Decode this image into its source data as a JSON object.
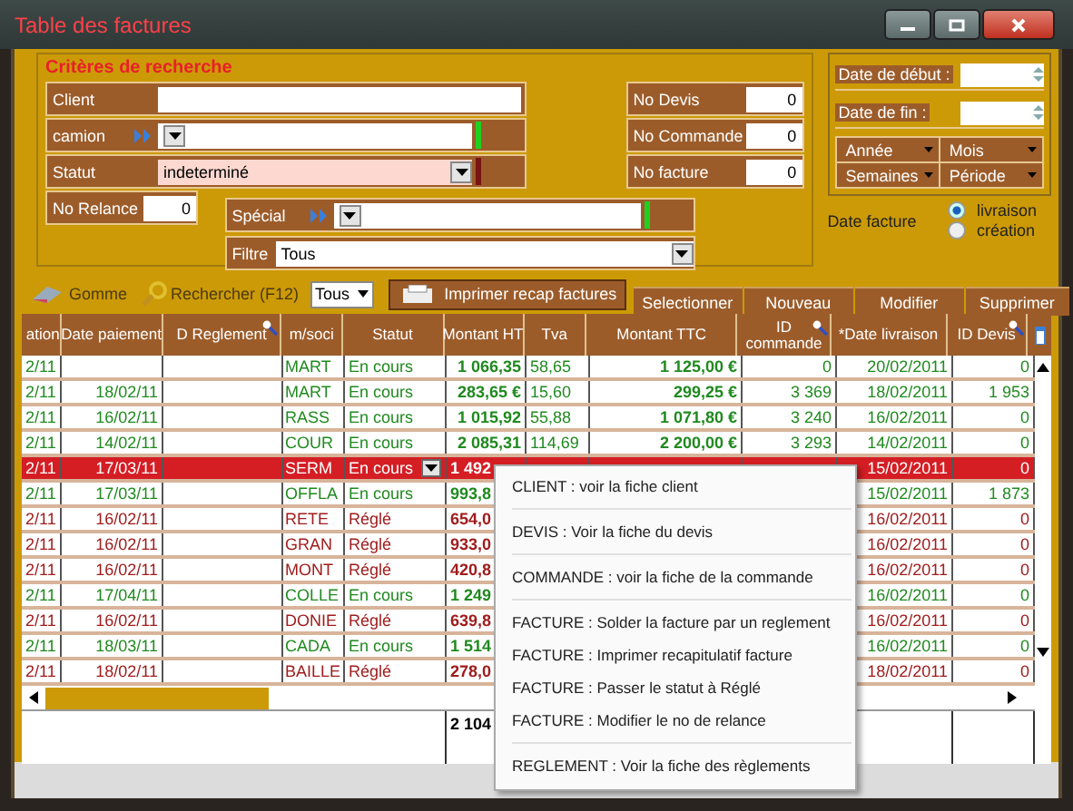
{
  "window": {
    "title": "Table des factures"
  },
  "criteria": {
    "title": "Critères de recherche",
    "client": {
      "label": "Client"
    },
    "camion": {
      "label": "camion"
    },
    "statut": {
      "label": "Statut",
      "value": "indeterminé"
    },
    "no_relance": {
      "label": "No Relance",
      "value": "0"
    },
    "numbers": [
      {
        "label": "No Devis",
        "value": "0"
      },
      {
        "label": "No Commande",
        "value": "0"
      },
      {
        "label": "No facture",
        "value": "0"
      }
    ],
    "special": {
      "label": "Spécial"
    },
    "filtre": {
      "label": "Filtre",
      "value": "Tous"
    },
    "dates": [
      {
        "label": "Date de début :"
      },
      {
        "label": "Date de fin :"
      }
    ],
    "periods": [
      "Année",
      "Mois",
      "Semaines",
      "Période"
    ],
    "date_facture": {
      "label": "Date facture",
      "options": [
        {
          "label": "livraison",
          "selected": true
        },
        {
          "label": "création",
          "selected": false
        }
      ]
    }
  },
  "toolbar": {
    "gomme": "Gomme",
    "search": "Rechercher (F12)",
    "scope": "Tous",
    "print": "Imprimer recap factures",
    "actions": [
      "Selectionner",
      "Nouveau",
      "Modifier",
      "Supprimer"
    ]
  },
  "table": {
    "columns": [
      {
        "label": "ation",
        "search_icon": false
      },
      {
        "label": "Date paiement",
        "search_icon": false
      },
      {
        "label": "D Reglement",
        "search_icon": true
      },
      {
        "label": "m/soci",
        "search_icon": false
      },
      {
        "label": "Statut",
        "search_icon": false
      },
      {
        "label": "Montant HT",
        "search_icon": false
      },
      {
        "label": "Tva",
        "search_icon": false
      },
      {
        "label": "Montant TTC",
        "search_icon": false
      },
      {
        "label": "ID commande",
        "search_icon": true
      },
      {
        "label": "*Date livraison",
        "search_icon": false
      },
      {
        "label": "ID Devis",
        "search_icon": true
      }
    ],
    "rows": [
      {
        "selected": false,
        "color": "#1f8a1f",
        "cells": {
          "column_1": "2/11",
          "column_4": "MART",
          "statut": "En cours",
          "montant_ht": "1 066,35",
          "tva": "58,65",
          "montant_ttc": "1 125,00 €",
          "id_commande": "0",
          "date_livraison": "20/02/2011",
          "id_devis": "0"
        }
      },
      {
        "selected": false,
        "color": "#1f8a1f",
        "cells": {
          "column_1": "2/11",
          "date_paiement": "18/02/11",
          "column_4": "MART",
          "statut": "En cours",
          "montant_ht": "283,65 €",
          "tva": "15,60",
          "montant_ttc": "299,25 €",
          "id_commande": "3 369",
          "date_livraison": "18/02/2011",
          "id_devis": "1 953"
        }
      },
      {
        "selected": false,
        "color": "#1f8a1f",
        "cells": {
          "column_1": "2/11",
          "date_paiement": "16/02/11",
          "column_4": "RASS",
          "statut": "En cours",
          "montant_ht": "1 015,92",
          "tva": "55,88",
          "montant_ttc": "1 071,80 €",
          "id_commande": "3 240",
          "date_livraison": "16/02/2011",
          "id_devis": "0"
        }
      },
      {
        "selected": false,
        "color": "#1f8a1f",
        "cells": {
          "column_1": "2/11",
          "date_paiement": "14/02/11",
          "column_4": "COUR",
          "statut": "En cours",
          "montant_ht": "2 085,31",
          "tva": "114,69",
          "montant_ttc": "2 200,00 €",
          "id_commande": "3 293",
          "date_livraison": "14/02/2011",
          "id_devis": "0"
        }
      },
      {
        "selected": true,
        "cells": {
          "column_1": "2/11",
          "date_paiement": "17/03/11",
          "column_4": "SERM",
          "statut": "En cours",
          "montant_ht": "1 492",
          "date_livraison": "15/02/2011",
          "id_devis": "0"
        }
      },
      {
        "selected": false,
        "color": "#1f8a1f",
        "cells": {
          "column_1": "2/11",
          "date_paiement": "17/03/11",
          "column_4": "OFFLA",
          "statut": "En cours",
          "montant_ht": "993,8",
          "date_livraison": "15/02/2011",
          "id_devis": "1 873"
        }
      },
      {
        "selected": false,
        "color": "#a01c1c",
        "cells": {
          "column_1": "2/11",
          "date_paiement": "16/02/11",
          "column_4": "RETE",
          "statut": "Réglé",
          "montant_ht": "654,0",
          "date_livraison": "16/02/2011",
          "id_devis": "0"
        }
      },
      {
        "selected": false,
        "color": "#a01c1c",
        "cells": {
          "column_1": "2/11",
          "date_paiement": "16/02/11",
          "column_4": "GRAN",
          "statut": "Réglé",
          "montant_ht": "933,0",
          "date_livraison": "16/02/2011",
          "id_devis": "0"
        }
      },
      {
        "selected": false,
        "color": "#a01c1c",
        "cells": {
          "column_1": "2/11",
          "date_paiement": "16/02/11",
          "column_4": "MONT",
          "statut": "Réglé",
          "montant_ht": "420,8",
          "date_livraison": "16/02/2011",
          "id_devis": "0"
        }
      },
      {
        "selected": false,
        "color": "#1f8a1f",
        "cells": {
          "column_1": "2/11",
          "date_paiement": "17/04/11",
          "column_4": "COLLE",
          "statut": "En cours",
          "montant_ht": "1 249",
          "date_livraison": "16/02/2011",
          "id_devis": "0"
        }
      },
      {
        "selected": false,
        "color": "#a01c1c",
        "cells": {
          "column_1": "2/11",
          "date_paiement": "16/02/11",
          "column_4": "DONIE",
          "statut": "Réglé",
          "montant_ht": "639,8",
          "date_livraison": "16/02/2011",
          "id_devis": "0"
        }
      },
      {
        "selected": false,
        "color": "#1f8a1f",
        "cells": {
          "column_1": "2/11",
          "date_paiement": "18/03/11",
          "column_4": "CADA",
          "statut": "En cours",
          "montant_ht": "1 514",
          "date_livraison": "16/02/2011",
          "id_devis": "0"
        }
      },
      {
        "selected": false,
        "color": "#a01c1c",
        "cells": {
          "column_1": "2/11",
          "date_paiement": "18/02/11",
          "column_4": "BAILLE",
          "statut": "Réglé",
          "montant_ht": "278,0",
          "date_livraison": "18/02/2011",
          "id_devis": "0"
        }
      }
    ],
    "totals": {
      "montant_ht": "2 104"
    }
  },
  "context_menu": {
    "groups": [
      [
        "CLIENT : voir la fiche client"
      ],
      [
        "DEVIS : Voir la fiche du devis"
      ],
      [
        "COMMANDE : voir la fiche de la commande"
      ],
      [
        "FACTURE : Solder la facture par un reglement",
        "FACTURE : Imprimer recapitulatif facture",
        "FACTURE : Passer le statut à Réglé",
        "FACTURE : Modifier le no de relance"
      ],
      [
        "REGLEMENT : Voir la fiche des règlements"
      ]
    ]
  }
}
